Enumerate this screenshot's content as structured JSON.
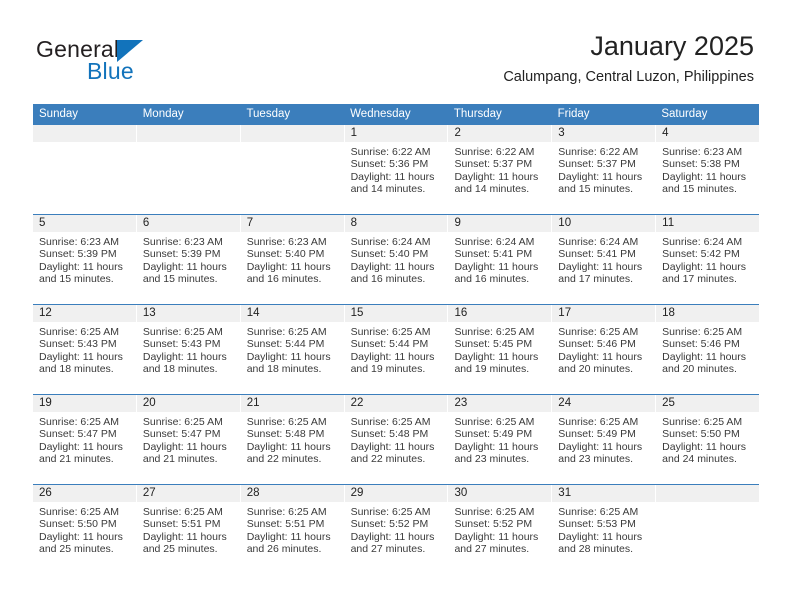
{
  "brand": {
    "name_part1": "General",
    "name_part2": "Blue",
    "accent_color": "#1273bb",
    "logo_icon": "triangle-flag-icon"
  },
  "header": {
    "title": "January 2025",
    "subtitle": "Calumpang, Central Luzon, Philippines"
  },
  "calendar": {
    "header_color": "#3b7ebc",
    "weekdays": [
      "Sunday",
      "Monday",
      "Tuesday",
      "Wednesday",
      "Thursday",
      "Friday",
      "Saturday"
    ],
    "weeks": [
      {
        "days": [
          {
            "num": "",
            "lines": []
          },
          {
            "num": "",
            "lines": []
          },
          {
            "num": "",
            "lines": []
          },
          {
            "num": "1",
            "lines": [
              "Sunrise: 6:22 AM",
              "Sunset: 5:36 PM",
              "Daylight: 11 hours",
              "and 14 minutes."
            ]
          },
          {
            "num": "2",
            "lines": [
              "Sunrise: 6:22 AM",
              "Sunset: 5:37 PM",
              "Daylight: 11 hours",
              "and 14 minutes."
            ]
          },
          {
            "num": "3",
            "lines": [
              "Sunrise: 6:22 AM",
              "Sunset: 5:37 PM",
              "Daylight: 11 hours",
              "and 15 minutes."
            ]
          },
          {
            "num": "4",
            "lines": [
              "Sunrise: 6:23 AM",
              "Sunset: 5:38 PM",
              "Daylight: 11 hours",
              "and 15 minutes."
            ]
          }
        ]
      },
      {
        "days": [
          {
            "num": "5",
            "lines": [
              "Sunrise: 6:23 AM",
              "Sunset: 5:39 PM",
              "Daylight: 11 hours",
              "and 15 minutes."
            ]
          },
          {
            "num": "6",
            "lines": [
              "Sunrise: 6:23 AM",
              "Sunset: 5:39 PM",
              "Daylight: 11 hours",
              "and 15 minutes."
            ]
          },
          {
            "num": "7",
            "lines": [
              "Sunrise: 6:23 AM",
              "Sunset: 5:40 PM",
              "Daylight: 11 hours",
              "and 16 minutes."
            ]
          },
          {
            "num": "8",
            "lines": [
              "Sunrise: 6:24 AM",
              "Sunset: 5:40 PM",
              "Daylight: 11 hours",
              "and 16 minutes."
            ]
          },
          {
            "num": "9",
            "lines": [
              "Sunrise: 6:24 AM",
              "Sunset: 5:41 PM",
              "Daylight: 11 hours",
              "and 16 minutes."
            ]
          },
          {
            "num": "10",
            "lines": [
              "Sunrise: 6:24 AM",
              "Sunset: 5:41 PM",
              "Daylight: 11 hours",
              "and 17 minutes."
            ]
          },
          {
            "num": "11",
            "lines": [
              "Sunrise: 6:24 AM",
              "Sunset: 5:42 PM",
              "Daylight: 11 hours",
              "and 17 minutes."
            ]
          }
        ]
      },
      {
        "days": [
          {
            "num": "12",
            "lines": [
              "Sunrise: 6:25 AM",
              "Sunset: 5:43 PM",
              "Daylight: 11 hours",
              "and 18 minutes."
            ]
          },
          {
            "num": "13",
            "lines": [
              "Sunrise: 6:25 AM",
              "Sunset: 5:43 PM",
              "Daylight: 11 hours",
              "and 18 minutes."
            ]
          },
          {
            "num": "14",
            "lines": [
              "Sunrise: 6:25 AM",
              "Sunset: 5:44 PM",
              "Daylight: 11 hours",
              "and 18 minutes."
            ]
          },
          {
            "num": "15",
            "lines": [
              "Sunrise: 6:25 AM",
              "Sunset: 5:44 PM",
              "Daylight: 11 hours",
              "and 19 minutes."
            ]
          },
          {
            "num": "16",
            "lines": [
              "Sunrise: 6:25 AM",
              "Sunset: 5:45 PM",
              "Daylight: 11 hours",
              "and 19 minutes."
            ]
          },
          {
            "num": "17",
            "lines": [
              "Sunrise: 6:25 AM",
              "Sunset: 5:46 PM",
              "Daylight: 11 hours",
              "and 20 minutes."
            ]
          },
          {
            "num": "18",
            "lines": [
              "Sunrise: 6:25 AM",
              "Sunset: 5:46 PM",
              "Daylight: 11 hours",
              "and 20 minutes."
            ]
          }
        ]
      },
      {
        "days": [
          {
            "num": "19",
            "lines": [
              "Sunrise: 6:25 AM",
              "Sunset: 5:47 PM",
              "Daylight: 11 hours",
              "and 21 minutes."
            ]
          },
          {
            "num": "20",
            "lines": [
              "Sunrise: 6:25 AM",
              "Sunset: 5:47 PM",
              "Daylight: 11 hours",
              "and 21 minutes."
            ]
          },
          {
            "num": "21",
            "lines": [
              "Sunrise: 6:25 AM",
              "Sunset: 5:48 PM",
              "Daylight: 11 hours",
              "and 22 minutes."
            ]
          },
          {
            "num": "22",
            "lines": [
              "Sunrise: 6:25 AM",
              "Sunset: 5:48 PM",
              "Daylight: 11 hours",
              "and 22 minutes."
            ]
          },
          {
            "num": "23",
            "lines": [
              "Sunrise: 6:25 AM",
              "Sunset: 5:49 PM",
              "Daylight: 11 hours",
              "and 23 minutes."
            ]
          },
          {
            "num": "24",
            "lines": [
              "Sunrise: 6:25 AM",
              "Sunset: 5:49 PM",
              "Daylight: 11 hours",
              "and 23 minutes."
            ]
          },
          {
            "num": "25",
            "lines": [
              "Sunrise: 6:25 AM",
              "Sunset: 5:50 PM",
              "Daylight: 11 hours",
              "and 24 minutes."
            ]
          }
        ]
      },
      {
        "days": [
          {
            "num": "26",
            "lines": [
              "Sunrise: 6:25 AM",
              "Sunset: 5:50 PM",
              "Daylight: 11 hours",
              "and 25 minutes."
            ]
          },
          {
            "num": "27",
            "lines": [
              "Sunrise: 6:25 AM",
              "Sunset: 5:51 PM",
              "Daylight: 11 hours",
              "and 25 minutes."
            ]
          },
          {
            "num": "28",
            "lines": [
              "Sunrise: 6:25 AM",
              "Sunset: 5:51 PM",
              "Daylight: 11 hours",
              "and 26 minutes."
            ]
          },
          {
            "num": "29",
            "lines": [
              "Sunrise: 6:25 AM",
              "Sunset: 5:52 PM",
              "Daylight: 11 hours",
              "and 27 minutes."
            ]
          },
          {
            "num": "30",
            "lines": [
              "Sunrise: 6:25 AM",
              "Sunset: 5:52 PM",
              "Daylight: 11 hours",
              "and 27 minutes."
            ]
          },
          {
            "num": "31",
            "lines": [
              "Sunrise: 6:25 AM",
              "Sunset: 5:53 PM",
              "Daylight: 11 hours",
              "and 28 minutes."
            ]
          },
          {
            "num": "",
            "lines": []
          }
        ]
      }
    ]
  }
}
